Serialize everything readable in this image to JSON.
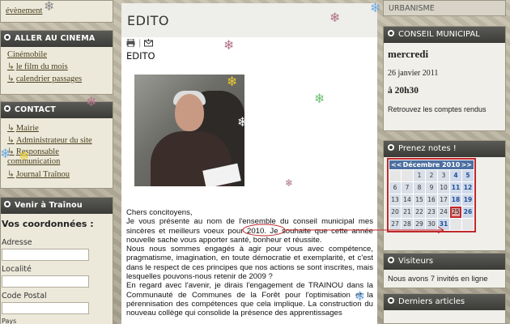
{
  "left": {
    "top_link": "évènement",
    "cinema": {
      "title": "ALLER AU CINEMA",
      "links": [
        "Cinémobile",
        "le film du mois",
        "calendrier passages"
      ]
    },
    "contact": {
      "title": "CONTACT",
      "links": [
        "Mairie",
        "Administrateur du site",
        "Responsable communication",
        "Journal Traînou"
      ]
    },
    "venir": {
      "title": "Venir à Traînou",
      "subtitle": "Vos coordonnées :",
      "fields": [
        "Adresse",
        "Localité",
        "Code Postal",
        "Pays"
      ]
    }
  },
  "center": {
    "title": "EDITO",
    "subtitle": "EDITO",
    "paragraphs": [
      "Chers concitoyens,",
      "Je vous présente au nom de l'ensemble du conseil municipal mes sincères et meilleurs voeux pour 2010. Je souhaite que cette année nouvelle sache vous apporter santé, bonheur et réussite.",
      "Nous nous sommes engagés à agir pour vous avec compétence, pragmatisme, imagination, en toute démocratie et exemplarité, et c'est dans le respect de ces principes que nos actions se sont inscrites, mais lesquelles pouvons-nous retenir de 2009 ?",
      "En regard avec l'avenir, je dirais l'engagement de TRAINOU dans la Communauté de Communes de la Forêt pour l'optimisation et la pérennisation des compétences que cela implique. La construction du nouveau collège qui consolide la présence des apprentissages"
    ]
  },
  "right": {
    "top_label": "URBANISME",
    "conseil": {
      "title": "CONSEIL MUNICIPAL",
      "day": "mercredi",
      "date": "26 janvier 2011",
      "time": "à 20h30",
      "note": "Retrouvez les comptes rendus"
    },
    "notes": {
      "title": "Prenez notes !",
      "month": "Décembre 2010",
      "prev": "<<",
      "next": ">>",
      "today": "25"
    },
    "visiteurs": {
      "title": "Visiteurs",
      "text": "Nous avons 7 invités en ligne"
    },
    "articles": {
      "title": "Derniers articles"
    }
  },
  "colors": {
    "header_dark": "#3b3b38",
    "calendar_border": "#c0282a",
    "calendar_head": "#4d6fa0",
    "snowflake_pink": "#b07088",
    "snowflake_yellow": "#e8cc2e",
    "snowflake_green": "#6fbf73",
    "snowflake_blue": "#6fa7dc"
  }
}
